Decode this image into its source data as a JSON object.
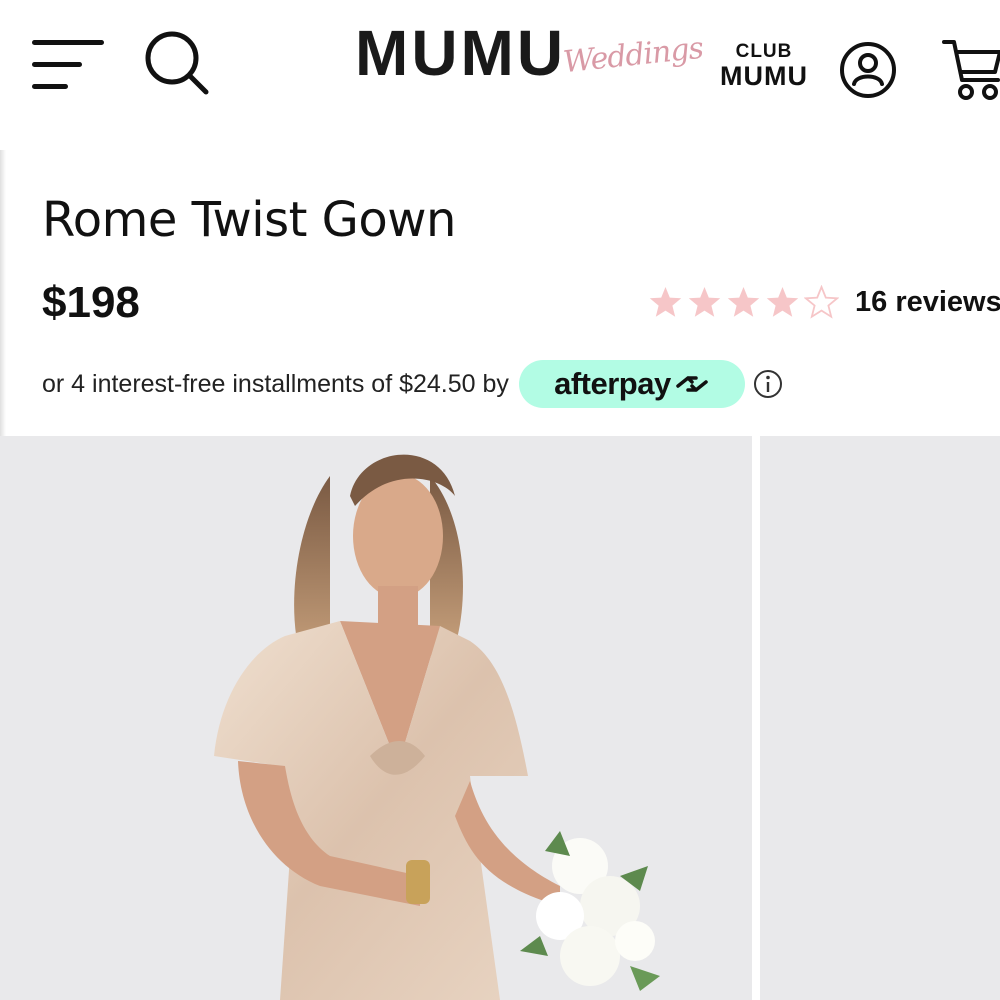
{
  "header": {
    "brand": "MUMU",
    "brand_script": "Weddings",
    "club_top": "CLUB",
    "club_bottom": "MUMU",
    "icons": [
      "menu-icon",
      "search-icon",
      "account-icon",
      "cart-icon"
    ]
  },
  "product": {
    "title": "Rome Twist Gown",
    "price": "$198",
    "rating": {
      "value": 4,
      "max": 5,
      "reviews_label": "16 reviews"
    },
    "installments": {
      "text": "or 4 interest-free installments of $24.50 by",
      "provider": "afterpay"
    }
  },
  "gallery": {
    "images": [
      "dress-photo",
      "next-photo"
    ]
  },
  "colors": {
    "star_filled": "#f6c6c8",
    "star_empty": "#f6c6c8",
    "afterpay_bg": "#b2fce4",
    "brand_script": "#d99aa6",
    "photo_bg": "#e9e9eb",
    "dress": "#e7d2c0"
  }
}
